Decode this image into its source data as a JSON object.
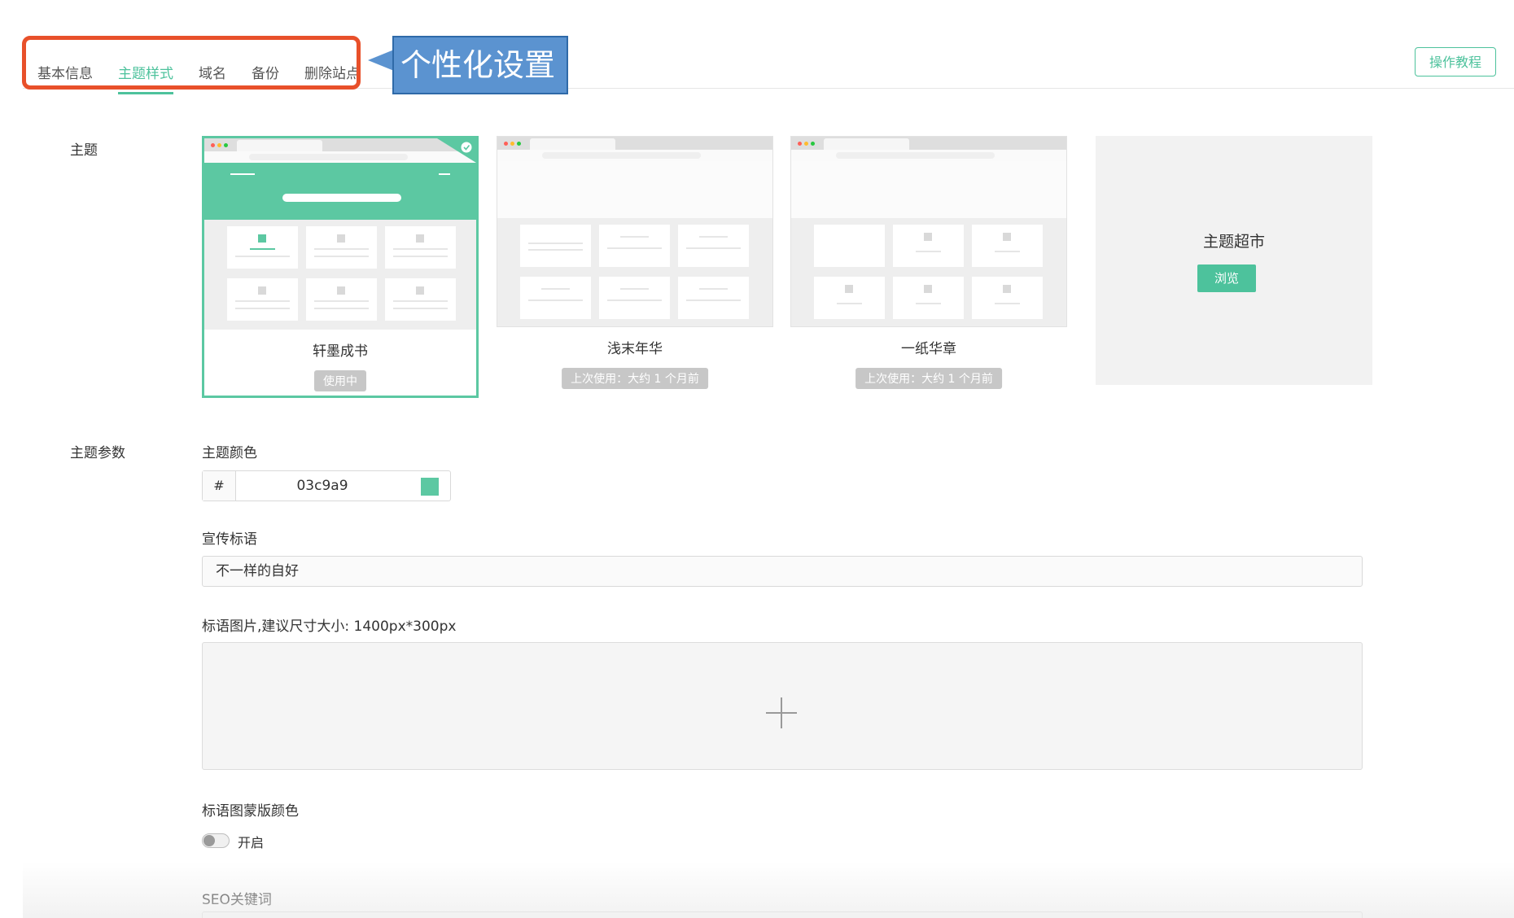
{
  "tabs": [
    {
      "label": "基本信息"
    },
    {
      "label": "主题样式",
      "active": true
    },
    {
      "label": "域名"
    },
    {
      "label": "备份"
    },
    {
      "label": "删除站点"
    }
  ],
  "callout": {
    "text": "个性化设置"
  },
  "tutorial_button": {
    "label": "操作教程"
  },
  "theme_section": {
    "label": "主题",
    "cards": [
      {
        "name": "轩墨成书",
        "badge": "使用中",
        "active": true
      },
      {
        "name": "浅末年华",
        "badge": "上次使用：大约 1 个月前"
      },
      {
        "name": "一纸华章",
        "badge": "上次使用：大约 1 个月前"
      }
    ],
    "market": {
      "title": "主题超市",
      "browse_label": "浏览"
    }
  },
  "params_section": {
    "label": "主题参数",
    "theme_color": {
      "label": "主题颜色",
      "prefix": "#",
      "value": "03c9a9",
      "swatch_color": "#5cc8a2"
    },
    "slogan": {
      "label": "宣传标语",
      "value": "不一样的自好"
    },
    "slogan_image": {
      "label": "标语图片,建议尺寸大小: 1400px*300px"
    },
    "overlay_color": {
      "label": "标语图蒙版颜色",
      "toggle_label": "开启",
      "enabled": false
    },
    "seo_keywords": {
      "label": "SEO关键词"
    }
  },
  "colors": {
    "accent": "#4dc29c",
    "highlight_border": "#e8502a",
    "callout_bg": "#5b93d0"
  }
}
